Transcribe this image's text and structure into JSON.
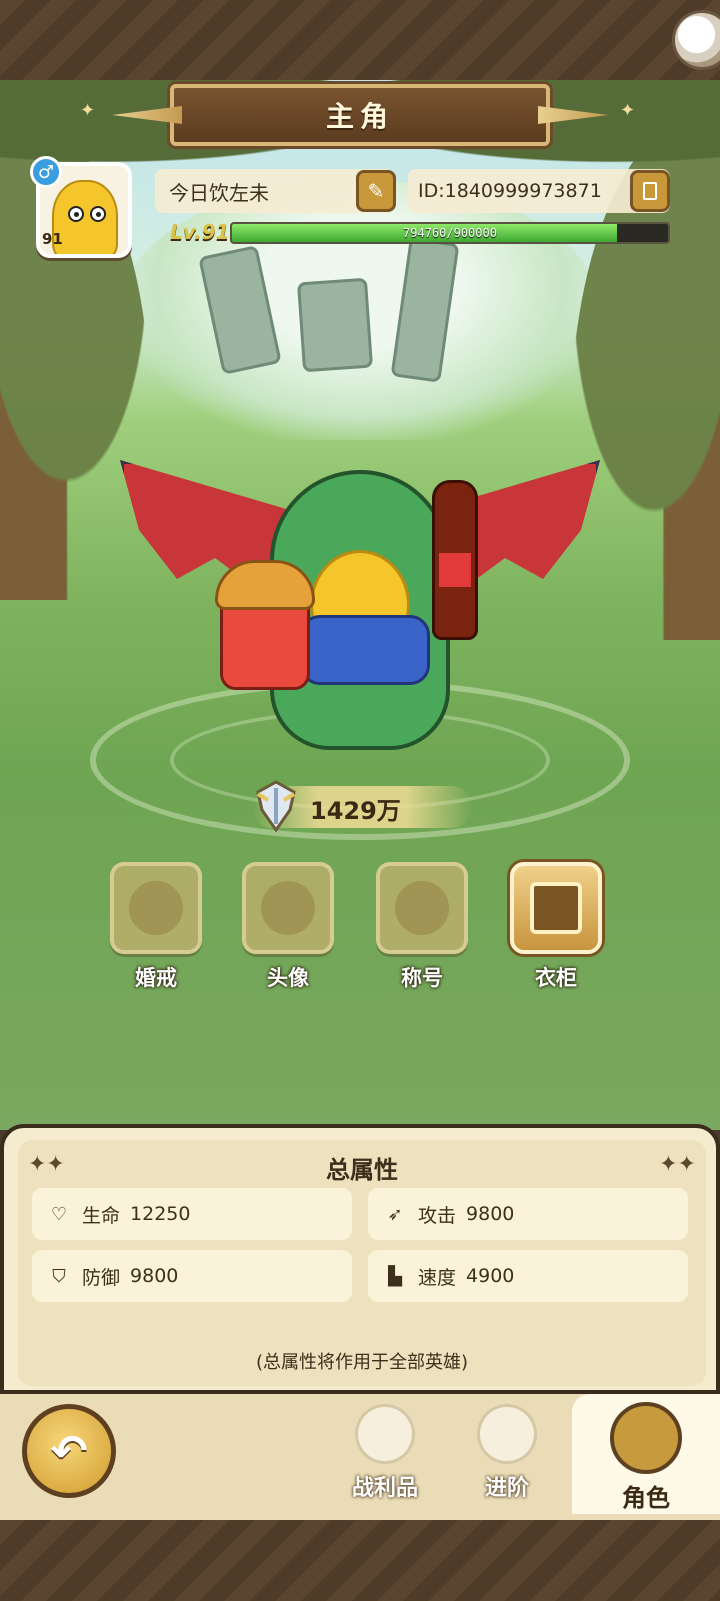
{
  "header": {
    "title": "主角"
  },
  "profile": {
    "gender_symbol": "♂",
    "avatar_level": "91",
    "name": "今日饮左未",
    "id_text": "ID:1840999973871",
    "level_label": "Lv.91",
    "xp_text": "794760/900000",
    "xp_fraction": 0.883
  },
  "power": {
    "value": "1429万"
  },
  "features": [
    {
      "label": "婚戒",
      "active": false
    },
    {
      "label": "头像",
      "active": false
    },
    {
      "label": "称号",
      "active": false
    },
    {
      "label": "衣柜",
      "active": true
    }
  ],
  "stats": {
    "title": "总属性",
    "items": [
      {
        "label": "生命",
        "value": "12250",
        "icon": "heart-icon"
      },
      {
        "label": "攻击",
        "value": "9800",
        "icon": "attack-icon"
      },
      {
        "label": "防御",
        "value": "9800",
        "icon": "shield-icon"
      },
      {
        "label": "速度",
        "value": "4900",
        "icon": "boot-icon"
      }
    ],
    "note": "(总属性将作用于全部英雄)"
  },
  "nav": {
    "items": [
      {
        "label": "战利品",
        "icon": "loot-icon"
      },
      {
        "label": "进阶",
        "icon": "advance-icon"
      },
      {
        "label": "角色",
        "icon": "character-icon",
        "active": true
      }
    ]
  },
  "colors": {
    "accent": "#c9983a",
    "xp": "#3ea832",
    "panel": "#f5ecd0"
  }
}
